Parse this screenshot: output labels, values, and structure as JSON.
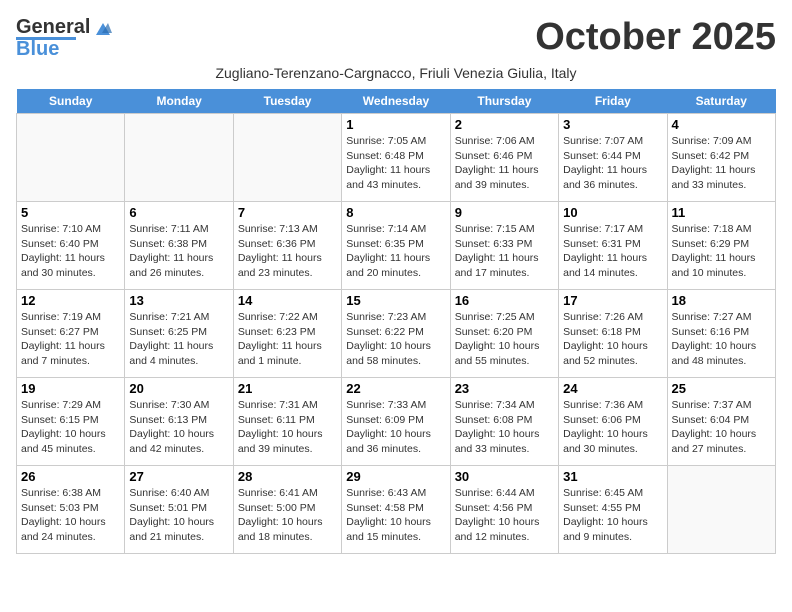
{
  "header": {
    "logo_line1": "General",
    "logo_line2": "Blue",
    "month_title": "October 2025",
    "subtitle": "Zugliano-Terenzano-Cargnacco, Friuli Venezia Giulia, Italy"
  },
  "days_of_week": [
    "Sunday",
    "Monday",
    "Tuesday",
    "Wednesday",
    "Thursday",
    "Friday",
    "Saturday"
  ],
  "weeks": [
    [
      {
        "date": "",
        "info": ""
      },
      {
        "date": "",
        "info": ""
      },
      {
        "date": "",
        "info": ""
      },
      {
        "date": "1",
        "info": "Sunrise: 7:05 AM\nSunset: 6:48 PM\nDaylight: 11 hours and 43 minutes."
      },
      {
        "date": "2",
        "info": "Sunrise: 7:06 AM\nSunset: 6:46 PM\nDaylight: 11 hours and 39 minutes."
      },
      {
        "date": "3",
        "info": "Sunrise: 7:07 AM\nSunset: 6:44 PM\nDaylight: 11 hours and 36 minutes."
      },
      {
        "date": "4",
        "info": "Sunrise: 7:09 AM\nSunset: 6:42 PM\nDaylight: 11 hours and 33 minutes."
      }
    ],
    [
      {
        "date": "5",
        "info": "Sunrise: 7:10 AM\nSunset: 6:40 PM\nDaylight: 11 hours and 30 minutes."
      },
      {
        "date": "6",
        "info": "Sunrise: 7:11 AM\nSunset: 6:38 PM\nDaylight: 11 hours and 26 minutes."
      },
      {
        "date": "7",
        "info": "Sunrise: 7:13 AM\nSunset: 6:36 PM\nDaylight: 11 hours and 23 minutes."
      },
      {
        "date": "8",
        "info": "Sunrise: 7:14 AM\nSunset: 6:35 PM\nDaylight: 11 hours and 20 minutes."
      },
      {
        "date": "9",
        "info": "Sunrise: 7:15 AM\nSunset: 6:33 PM\nDaylight: 11 hours and 17 minutes."
      },
      {
        "date": "10",
        "info": "Sunrise: 7:17 AM\nSunset: 6:31 PM\nDaylight: 11 hours and 14 minutes."
      },
      {
        "date": "11",
        "info": "Sunrise: 7:18 AM\nSunset: 6:29 PM\nDaylight: 11 hours and 10 minutes."
      }
    ],
    [
      {
        "date": "12",
        "info": "Sunrise: 7:19 AM\nSunset: 6:27 PM\nDaylight: 11 hours and 7 minutes."
      },
      {
        "date": "13",
        "info": "Sunrise: 7:21 AM\nSunset: 6:25 PM\nDaylight: 11 hours and 4 minutes."
      },
      {
        "date": "14",
        "info": "Sunrise: 7:22 AM\nSunset: 6:23 PM\nDaylight: 11 hours and 1 minute."
      },
      {
        "date": "15",
        "info": "Sunrise: 7:23 AM\nSunset: 6:22 PM\nDaylight: 10 hours and 58 minutes."
      },
      {
        "date": "16",
        "info": "Sunrise: 7:25 AM\nSunset: 6:20 PM\nDaylight: 10 hours and 55 minutes."
      },
      {
        "date": "17",
        "info": "Sunrise: 7:26 AM\nSunset: 6:18 PM\nDaylight: 10 hours and 52 minutes."
      },
      {
        "date": "18",
        "info": "Sunrise: 7:27 AM\nSunset: 6:16 PM\nDaylight: 10 hours and 48 minutes."
      }
    ],
    [
      {
        "date": "19",
        "info": "Sunrise: 7:29 AM\nSunset: 6:15 PM\nDaylight: 10 hours and 45 minutes."
      },
      {
        "date": "20",
        "info": "Sunrise: 7:30 AM\nSunset: 6:13 PM\nDaylight: 10 hours and 42 minutes."
      },
      {
        "date": "21",
        "info": "Sunrise: 7:31 AM\nSunset: 6:11 PM\nDaylight: 10 hours and 39 minutes."
      },
      {
        "date": "22",
        "info": "Sunrise: 7:33 AM\nSunset: 6:09 PM\nDaylight: 10 hours and 36 minutes."
      },
      {
        "date": "23",
        "info": "Sunrise: 7:34 AM\nSunset: 6:08 PM\nDaylight: 10 hours and 33 minutes."
      },
      {
        "date": "24",
        "info": "Sunrise: 7:36 AM\nSunset: 6:06 PM\nDaylight: 10 hours and 30 minutes."
      },
      {
        "date": "25",
        "info": "Sunrise: 7:37 AM\nSunset: 6:04 PM\nDaylight: 10 hours and 27 minutes."
      }
    ],
    [
      {
        "date": "26",
        "info": "Sunrise: 6:38 AM\nSunset: 5:03 PM\nDaylight: 10 hours and 24 minutes."
      },
      {
        "date": "27",
        "info": "Sunrise: 6:40 AM\nSunset: 5:01 PM\nDaylight: 10 hours and 21 minutes."
      },
      {
        "date": "28",
        "info": "Sunrise: 6:41 AM\nSunset: 5:00 PM\nDaylight: 10 hours and 18 minutes."
      },
      {
        "date": "29",
        "info": "Sunrise: 6:43 AM\nSunset: 4:58 PM\nDaylight: 10 hours and 15 minutes."
      },
      {
        "date": "30",
        "info": "Sunrise: 6:44 AM\nSunset: 4:56 PM\nDaylight: 10 hours and 12 minutes."
      },
      {
        "date": "31",
        "info": "Sunrise: 6:45 AM\nSunset: 4:55 PM\nDaylight: 10 hours and 9 minutes."
      },
      {
        "date": "",
        "info": ""
      }
    ]
  ]
}
